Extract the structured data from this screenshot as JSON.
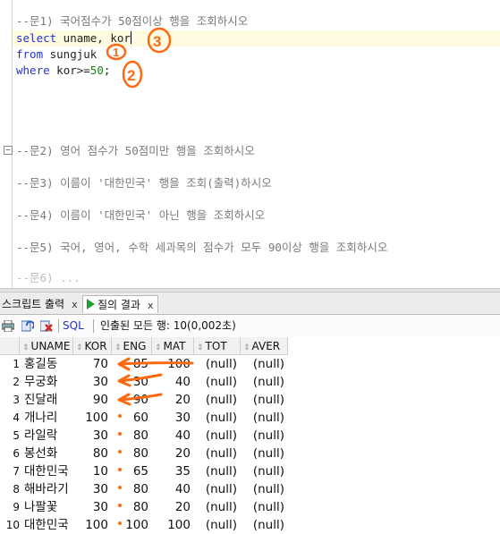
{
  "editor": {
    "lines": [
      {
        "name": "comment-q1",
        "text": "--문1) 국어점수가 50점이상 행을 조회하시오",
        "kind": "cm"
      },
      {
        "name": "sql-select-line",
        "kind": "select",
        "kw": "select",
        "rest": " uname, kor"
      },
      {
        "name": "sql-from-line",
        "kind": "kwline",
        "kw": "from",
        "rest": " sungjuk"
      },
      {
        "name": "sql-where-line",
        "kind": "where",
        "kw": "where",
        "rest": " kor>=",
        "num": "50",
        "end": ";"
      },
      {
        "name": "comment-q2",
        "text": "--문2) 영어 점수가 50점미만 행을 조회하시오",
        "kind": "cm"
      },
      {
        "name": "comment-q3",
        "text": "--문3) 이름이 '대한민국' 행을 조회(출력)하시오",
        "kind": "cm"
      },
      {
        "name": "comment-q4",
        "text": "--문4) 이름이 '대한민국' 아닌 행을 조회하시오",
        "kind": "cm"
      },
      {
        "name": "comment-q5",
        "text": "--문5) 국어, 영어, 수학 세과목의 점수가 모두 90이상 행을 조회하시오",
        "kind": "cm"
      }
    ],
    "fold_glyph": "⊟",
    "annotations": [
      "1",
      "2",
      "3"
    ]
  },
  "tabs": [
    {
      "label": "스크립트 출력",
      "close": "x"
    },
    {
      "label": "질의 결과",
      "close": "x"
    }
  ],
  "toolbar": {
    "sql_label": "SQL",
    "status": "인출된 모든 행: 10(0,002초)"
  },
  "grid": {
    "columns": [
      "UNAME",
      "KOR",
      "ENG",
      "MAT",
      "TOT",
      "AVER"
    ],
    "rows": [
      [
        "1",
        "홍길동",
        "70",
        "85",
        "100",
        "(null)",
        "(null)"
      ],
      [
        "2",
        "무궁화",
        "30",
        "30",
        "40",
        "(null)",
        "(null)"
      ],
      [
        "3",
        "진달래",
        "90",
        "90",
        "20",
        "(null)",
        "(null)"
      ],
      [
        "4",
        "개나리",
        "100",
        "60",
        "30",
        "(null)",
        "(null)"
      ],
      [
        "5",
        "라일락",
        "30",
        "80",
        "40",
        "(null)",
        "(null)"
      ],
      [
        "6",
        "봉선화",
        "80",
        "80",
        "20",
        "(null)",
        "(null)"
      ],
      [
        "7",
        "대한민국",
        "10",
        "65",
        "35",
        "(null)",
        "(null)"
      ],
      [
        "8",
        "해바라기",
        "30",
        "80",
        "40",
        "(null)",
        "(null)"
      ],
      [
        "9",
        "나팔꽃",
        "30",
        "80",
        "20",
        "(null)",
        "(null)"
      ],
      [
        "10",
        "대한민국",
        "100",
        "100",
        "100",
        "(null)",
        "(null)"
      ]
    ]
  },
  "colors": {
    "keyword": "#2233cc",
    "comment": "#7a7a7a",
    "number": "#1a7a1a",
    "annotation": "#ff6a10"
  }
}
